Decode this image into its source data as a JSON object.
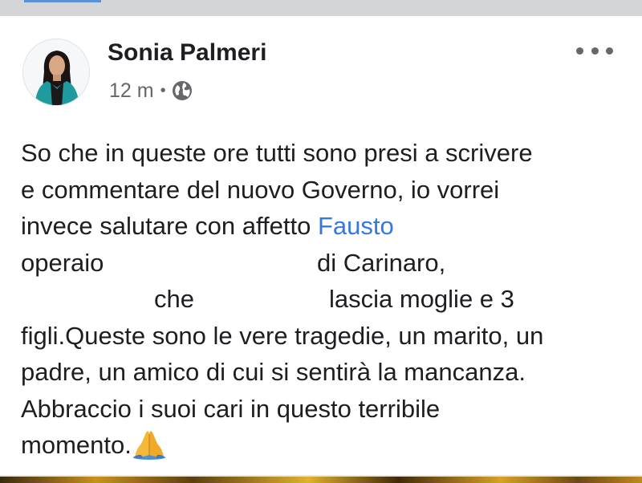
{
  "post": {
    "author": "Sonia Palmeri",
    "time": "12 m",
    "separator": "•",
    "audience_icon": "globe-icon",
    "more_icon": "more-horizontal-icon",
    "lines": {
      "l1": "So che in queste ore tutti sono presi a scrivere",
      "l2": "e commentare del nuovo Governo, io vorrei",
      "l3_text": "invece salutare con affetto ",
      "l3_mention": "Fausto",
      "l4_a": "operaio",
      "l4_b": "di Carinaro,",
      "l5_a": "che",
      "l5_b": "lascia moglie e 3",
      "l6": "figli.Queste sono le vere tragedie, un marito, un",
      "l7": "padre, un amico di cui si sentirà la mancanza.",
      "l8": "Abbraccio i suoi cari in questo terribile",
      "l9": "momento."
    },
    "end_emoji": "folded-hands-emoji"
  },
  "colors": {
    "name_text": "#1c1e21",
    "meta_text": "#65676b",
    "mention": "#3578e5"
  }
}
